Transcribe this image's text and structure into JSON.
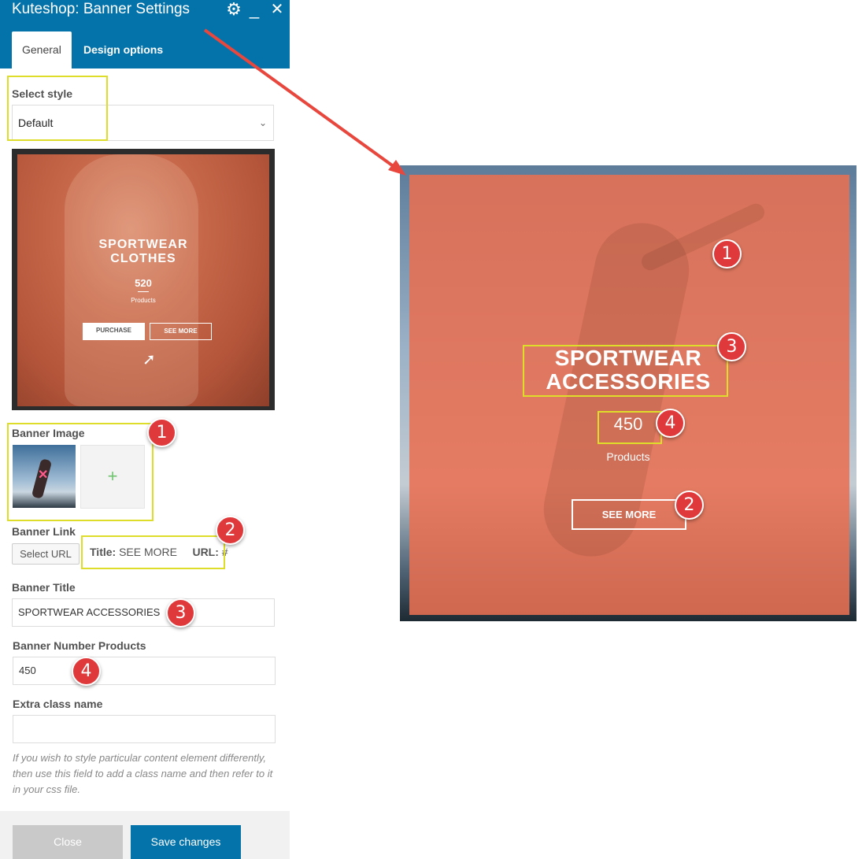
{
  "window": {
    "title": "Kuteshop: Banner Settings",
    "gear_icon": "gear-icon",
    "minimize_icon": "minimize-icon",
    "close_icon": "close-icon"
  },
  "tabs": [
    {
      "label": "General",
      "active": true
    },
    {
      "label": "Design options",
      "active": false
    }
  ],
  "form": {
    "select_style_label": "Select style",
    "select_style_value": "Default",
    "preview": {
      "title_line1": "SPORTWEAR",
      "title_line2": "CLOTHES",
      "number": "520",
      "products": "Products",
      "purchase": "PURCHASE",
      "see_more": "SEE MORE"
    },
    "banner_image_label": "Banner Image",
    "add_image_symbol": "+",
    "banner_link_label": "Banner Link",
    "select_url_button": "Select URL",
    "link_title_label": "Title:",
    "link_title_value": "SEE MORE",
    "link_url_label": "URL:",
    "link_url_value": "#",
    "banner_title_label": "Banner Title",
    "banner_title_value": "SPORTWEAR ACCESSORIES",
    "banner_number_label": "Banner Number Products",
    "banner_number_value": "450",
    "extra_class_label": "Extra class name",
    "extra_class_value": "",
    "help_text": "If you wish to style particular content element differently, then use this field to add a class name and then refer to it in your css file."
  },
  "footer": {
    "close_button": "Close",
    "save_button": "Save changes"
  },
  "banner": {
    "title_line1": "SPORTWEAR",
    "title_line2": "ACCESSORIES",
    "number": "450",
    "products": "Products",
    "see_more": "SEE MORE"
  },
  "markers": {
    "m1": "1",
    "m2": "2",
    "m3": "3",
    "m4": "4"
  },
  "colors": {
    "brand_blue": "#0473aa",
    "highlight_yellow": "#dede2a",
    "marker_red": "#e0393b",
    "arrow_red": "#e8473e",
    "banner_overlay": "#e87052"
  }
}
